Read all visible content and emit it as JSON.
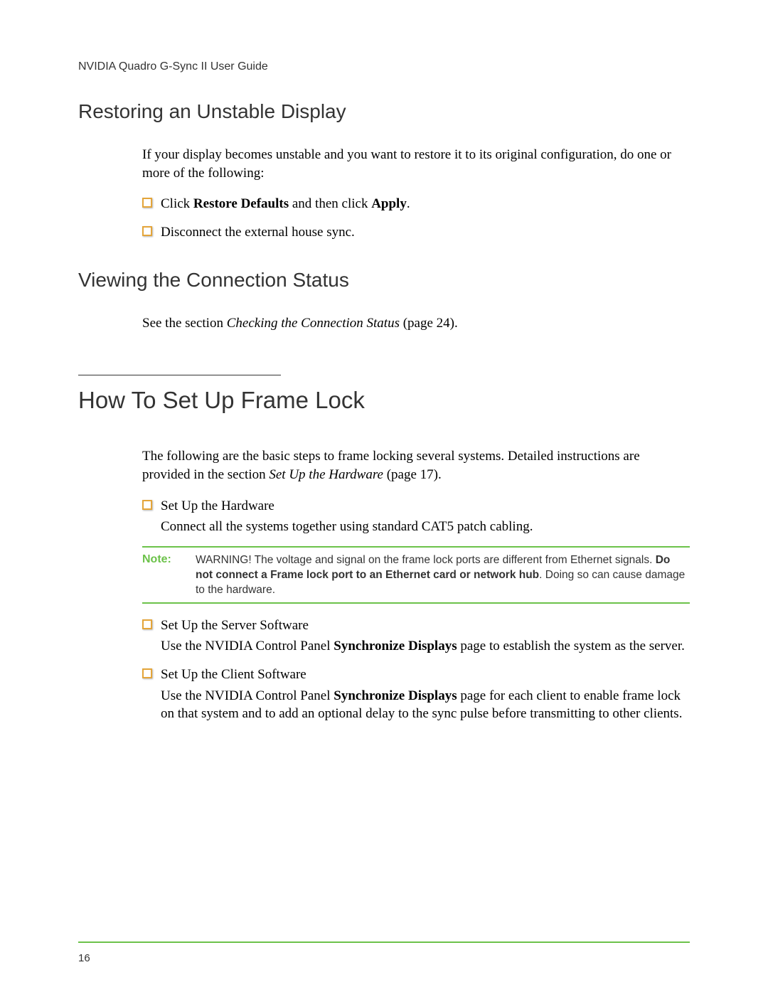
{
  "header": "NVIDIA Quadro G-Sync II User Guide",
  "sections": {
    "restoring": {
      "heading": "Restoring an Unstable Display",
      "intro": "If your display becomes unstable and you want to restore it to its original configuration, do one or more of the following:",
      "bullet1_pre": "Click ",
      "bullet1_b1": "Restore Defaults",
      "bullet1_mid": " and then click ",
      "bullet1_b2": "Apply",
      "bullet1_post": ".",
      "bullet2": "Disconnect the external house sync."
    },
    "viewing": {
      "heading": "Viewing the Connection Status",
      "text_pre": "See the section ",
      "text_italic": "Checking the Connection Status",
      "text_post": " (page 24)."
    },
    "framelock": {
      "heading": "How To Set Up Frame Lock",
      "intro_pre": "The following are the basic steps to frame locking several systems. Detailed instructions are provided in the section ",
      "intro_italic": "Set Up the Hardware",
      "intro_post": " (page 17).",
      "b1_title": "Set Up the Hardware",
      "b1_body": "Connect all the systems together using standard CAT5 patch cabling.",
      "note_label": "Note:",
      "note_pre": "WARNING! The voltage and signal on the frame lock ports are different from Ethernet signals. ",
      "note_bold": "Do not connect a Frame lock port to an Ethernet card or network hub",
      "note_post": ". Doing so can cause damage to the hardware.",
      "b2_title": "Set Up the Server Software",
      "b2_body_pre": "Use the NVIDIA Control Panel ",
      "b2_body_bold": "Synchronize Displays",
      "b2_body_post": " page to establish the system as the server.",
      "b3_title": "Set Up the Client Software",
      "b3_body_pre": "Use the NVIDIA Control Panel ",
      "b3_body_bold": "Synchronize Displays",
      "b3_body_post": " page for each client to enable frame lock on that system and to add an optional delay to the sync pulse before transmitting to other clients."
    }
  },
  "page_number": "16"
}
